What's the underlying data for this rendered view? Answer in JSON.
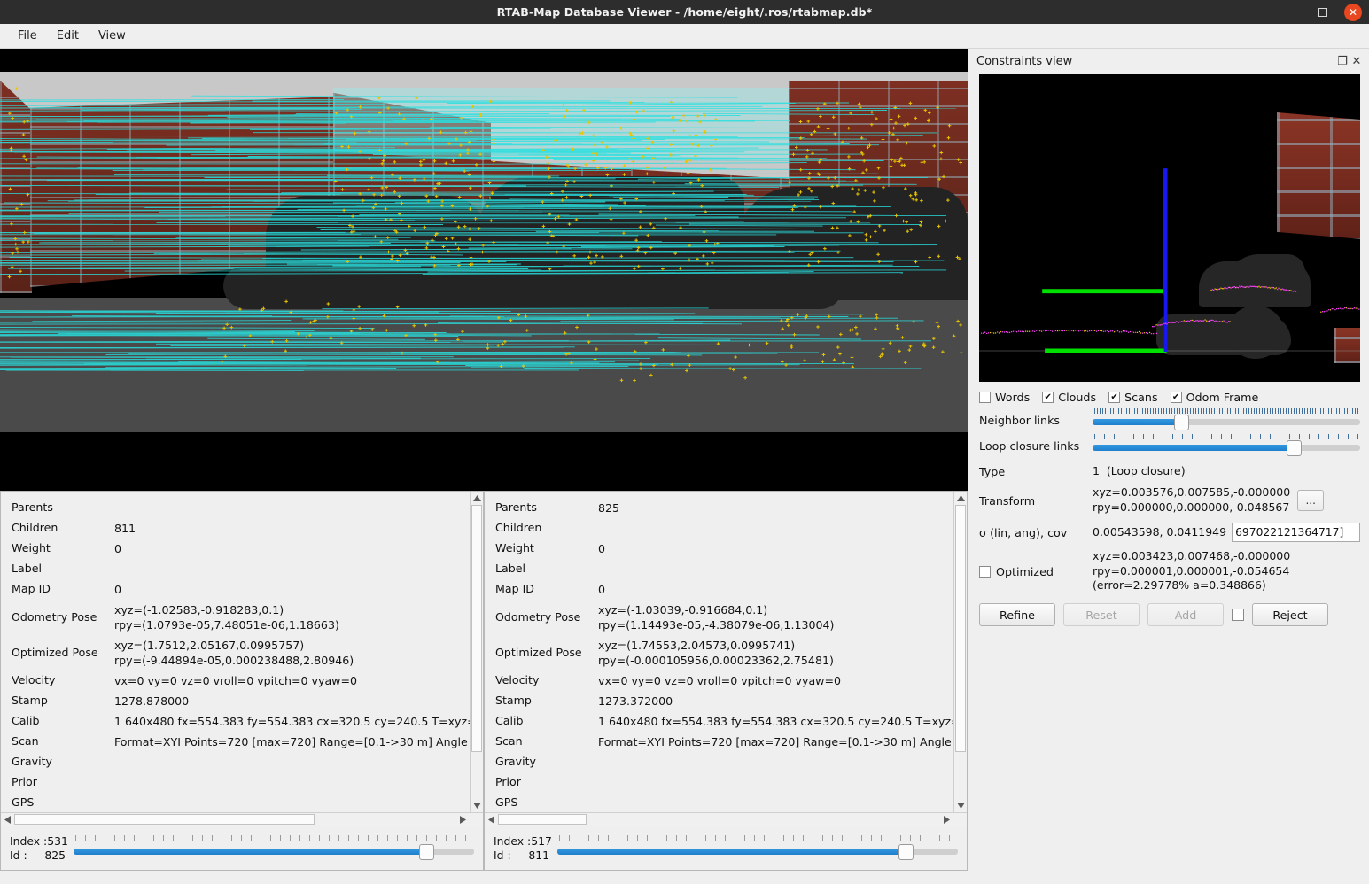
{
  "window": {
    "title": "RTAB-Map Database Viewer - /home/eight/.ros/rtabmap.db*",
    "minimize_label": "minimize",
    "maximize_label": "maximize",
    "close_label": "✕"
  },
  "menubar": {
    "items": [
      {
        "label": "File"
      },
      {
        "label": "Edit"
      },
      {
        "label": "View"
      }
    ]
  },
  "left_panel": {
    "rows": [
      {
        "key": "Parents",
        "value": ""
      },
      {
        "key": "Children",
        "value": "811"
      },
      {
        "key": "Weight",
        "value": "0"
      },
      {
        "key": "Label",
        "value": ""
      },
      {
        "key": "Map ID",
        "value": "0"
      },
      {
        "key": "Odometry Pose",
        "value": "xyz=(-1.02583,-0.918283,0.1)\nrpy=(1.0793e-05,7.48051e-06,1.18663)"
      },
      {
        "key": "Optimized Pose",
        "value": "xyz=(1.7512,2.05167,0.0995757)\nrpy=(-9.44894e-05,0.000238488,2.80946)"
      },
      {
        "key": "Velocity",
        "value": "vx=0 vy=0 vz=0 vroll=0 vpitch=0 vyaw=0"
      },
      {
        "key": "Stamp",
        "value": "1278.878000"
      },
      {
        "key": "Calib",
        "value": "1 640x480 fx=554.383 fy=554.383 cx=320.5 cy=240.5 T=xyz="
      },
      {
        "key": "Scan",
        "value": "Format=XYI Points=720 [max=720] Range=[0.1->30 m] Angle"
      },
      {
        "key": "Gravity",
        "value": ""
      },
      {
        "key": "Prior",
        "value": ""
      },
      {
        "key": "GPS",
        "value": ""
      }
    ],
    "slider": {
      "index_label": "Index :531",
      "id_label": "Id :     825",
      "fill_percent": 88
    }
  },
  "right_panel": {
    "rows": [
      {
        "key": "Parents",
        "value": "825"
      },
      {
        "key": "Children",
        "value": ""
      },
      {
        "key": "Weight",
        "value": "0"
      },
      {
        "key": "Label",
        "value": ""
      },
      {
        "key": "Map ID",
        "value": "0"
      },
      {
        "key": "Odometry Pose",
        "value": "xyz=(-1.03039,-0.916684,0.1)\nrpy=(1.14493e-05,-4.38079e-06,1.13004)"
      },
      {
        "key": "Optimized Pose",
        "value": "xyz=(1.74553,2.04573,0.0995741)\nrpy=(-0.000105956,0.00023362,2.75481)"
      },
      {
        "key": "Velocity",
        "value": "vx=0 vy=0 vz=0 vroll=0 vpitch=0 vyaw=0"
      },
      {
        "key": "Stamp",
        "value": "1273.372000"
      },
      {
        "key": "Calib",
        "value": "1 640x480 fx=554.383 fy=554.383 cx=320.5 cy=240.5 T=xyz="
      },
      {
        "key": "Scan",
        "value": "Format=XYI Points=720 [max=720] Range=[0.1->30 m] Angle"
      },
      {
        "key": "Gravity",
        "value": ""
      },
      {
        "key": "Prior",
        "value": ""
      },
      {
        "key": "GPS",
        "value": ""
      }
    ],
    "slider": {
      "index_label": "Index :517",
      "id_label": "Id :     811",
      "fill_percent": 87
    }
  },
  "constraints_dock": {
    "title": "Constraints view",
    "float_button": "❐",
    "close_button": "✕",
    "checkboxes": [
      {
        "label": "Words",
        "checked": false
      },
      {
        "label": "Clouds",
        "checked": true
      },
      {
        "label": "Scans",
        "checked": true
      },
      {
        "label": "Odom Frame",
        "checked": true
      }
    ],
    "link_sliders": [
      {
        "label": "Neighbor links",
        "fill_percent": 33,
        "tick_spacing": 3
      },
      {
        "label": "Loop closure links",
        "fill_percent": 75,
        "tick_spacing": 11
      }
    ],
    "type_label": "Type",
    "type_value": "1  (Loop closure)",
    "transform_label": "Transform",
    "transform_value": "xyz=0.003576,0.007585,-0.000000\nrpy=0.000000,0.000000,-0.048567",
    "transform_more_button": "...",
    "sigma_label": "σ (lin, ang), cov",
    "sigma_value": "0.00543598, 0.0411949",
    "cov_input_value": "697022121364717]",
    "optimized_label": "Optimized",
    "optimized_checked": false,
    "optimized_value": "xyz=0.003423,0.007468,-0.000000\nrpy=0.000001,0.000001,-0.054654\n(error=2.29778% a=0.348866)",
    "buttons": [
      {
        "label": "Refine",
        "enabled": true
      },
      {
        "label": "Reset",
        "enabled": false
      },
      {
        "label": "Add",
        "enabled": false
      },
      {
        "label": "Reject",
        "enabled": true
      }
    ]
  },
  "colors": {
    "accent_blue": "#2b87d6",
    "keypoint_yellow": "#e8c400",
    "match_cyan": "#28e0e0",
    "axis_green": "#00e000",
    "axis_blue": "#1818ee",
    "scan_magenta": "#ff40ff",
    "close_orange": "#e8471f",
    "titlebar_dark": "#2d2d2d",
    "panel_gray": "#efefef"
  }
}
